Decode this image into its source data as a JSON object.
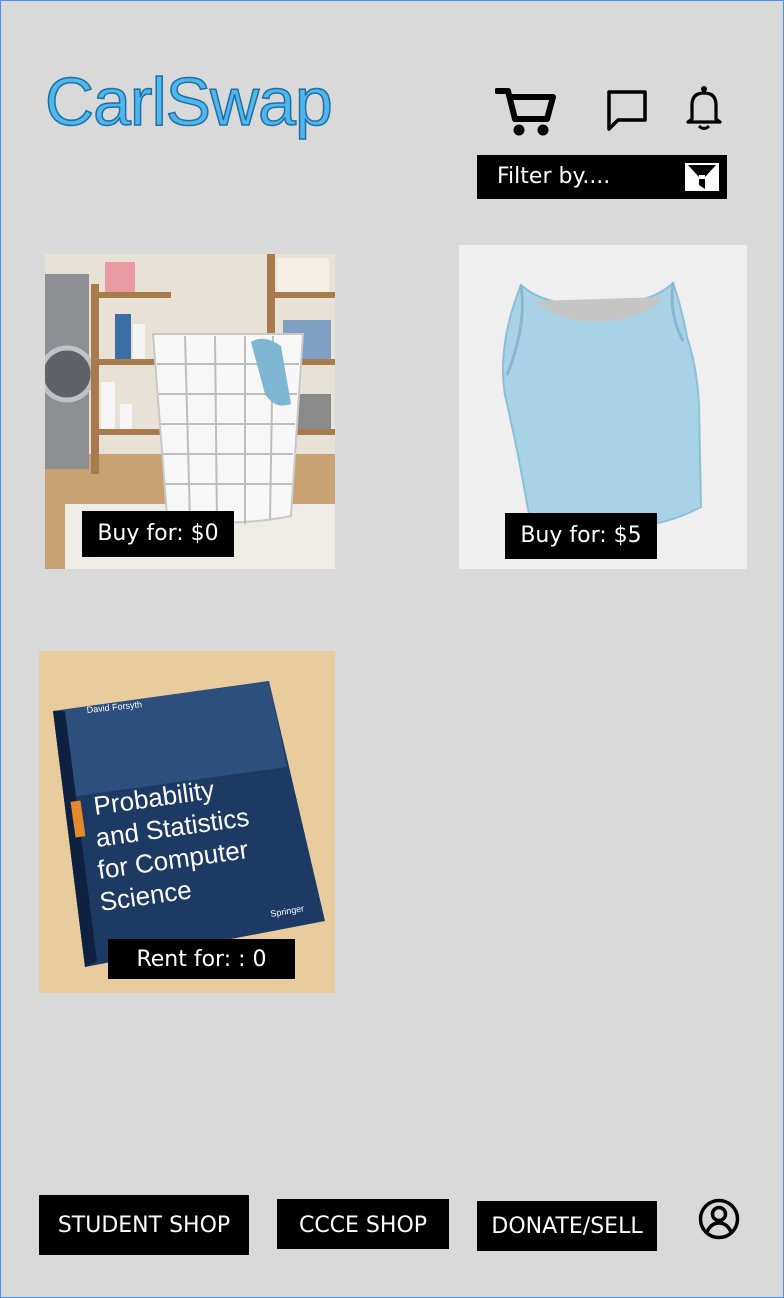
{
  "header": {
    "logo": "CarlSwap",
    "icons": [
      "cart-icon",
      "chat-icon",
      "bell-icon"
    ]
  },
  "filter": {
    "label": "Filter by....",
    "icon": "filter-icon"
  },
  "products": [
    {
      "item": "laundry basket",
      "price_label": "Buy for: $0"
    },
    {
      "item": "light blue crop top",
      "price_label": "Buy for: $5"
    },
    {
      "item": "textbook",
      "price_label": "Rent for: : 0",
      "book_author": "David Forsyth",
      "book_title": [
        "Probability",
        "and Statistics",
        "for Computer",
        "Science"
      ],
      "book_publisher": "Springer"
    }
  ],
  "bottom_nav": {
    "student_shop": "STUDENT SHOP",
    "ccce_shop": "CCCE SHOP",
    "donate_sell": "DONATE/SELL",
    "profile_icon": "profile-icon"
  },
  "colors": {
    "background": "#d9d9d9",
    "logo": "#4fb6ee",
    "frame_border": "#4a90e2",
    "button": "#000000"
  }
}
